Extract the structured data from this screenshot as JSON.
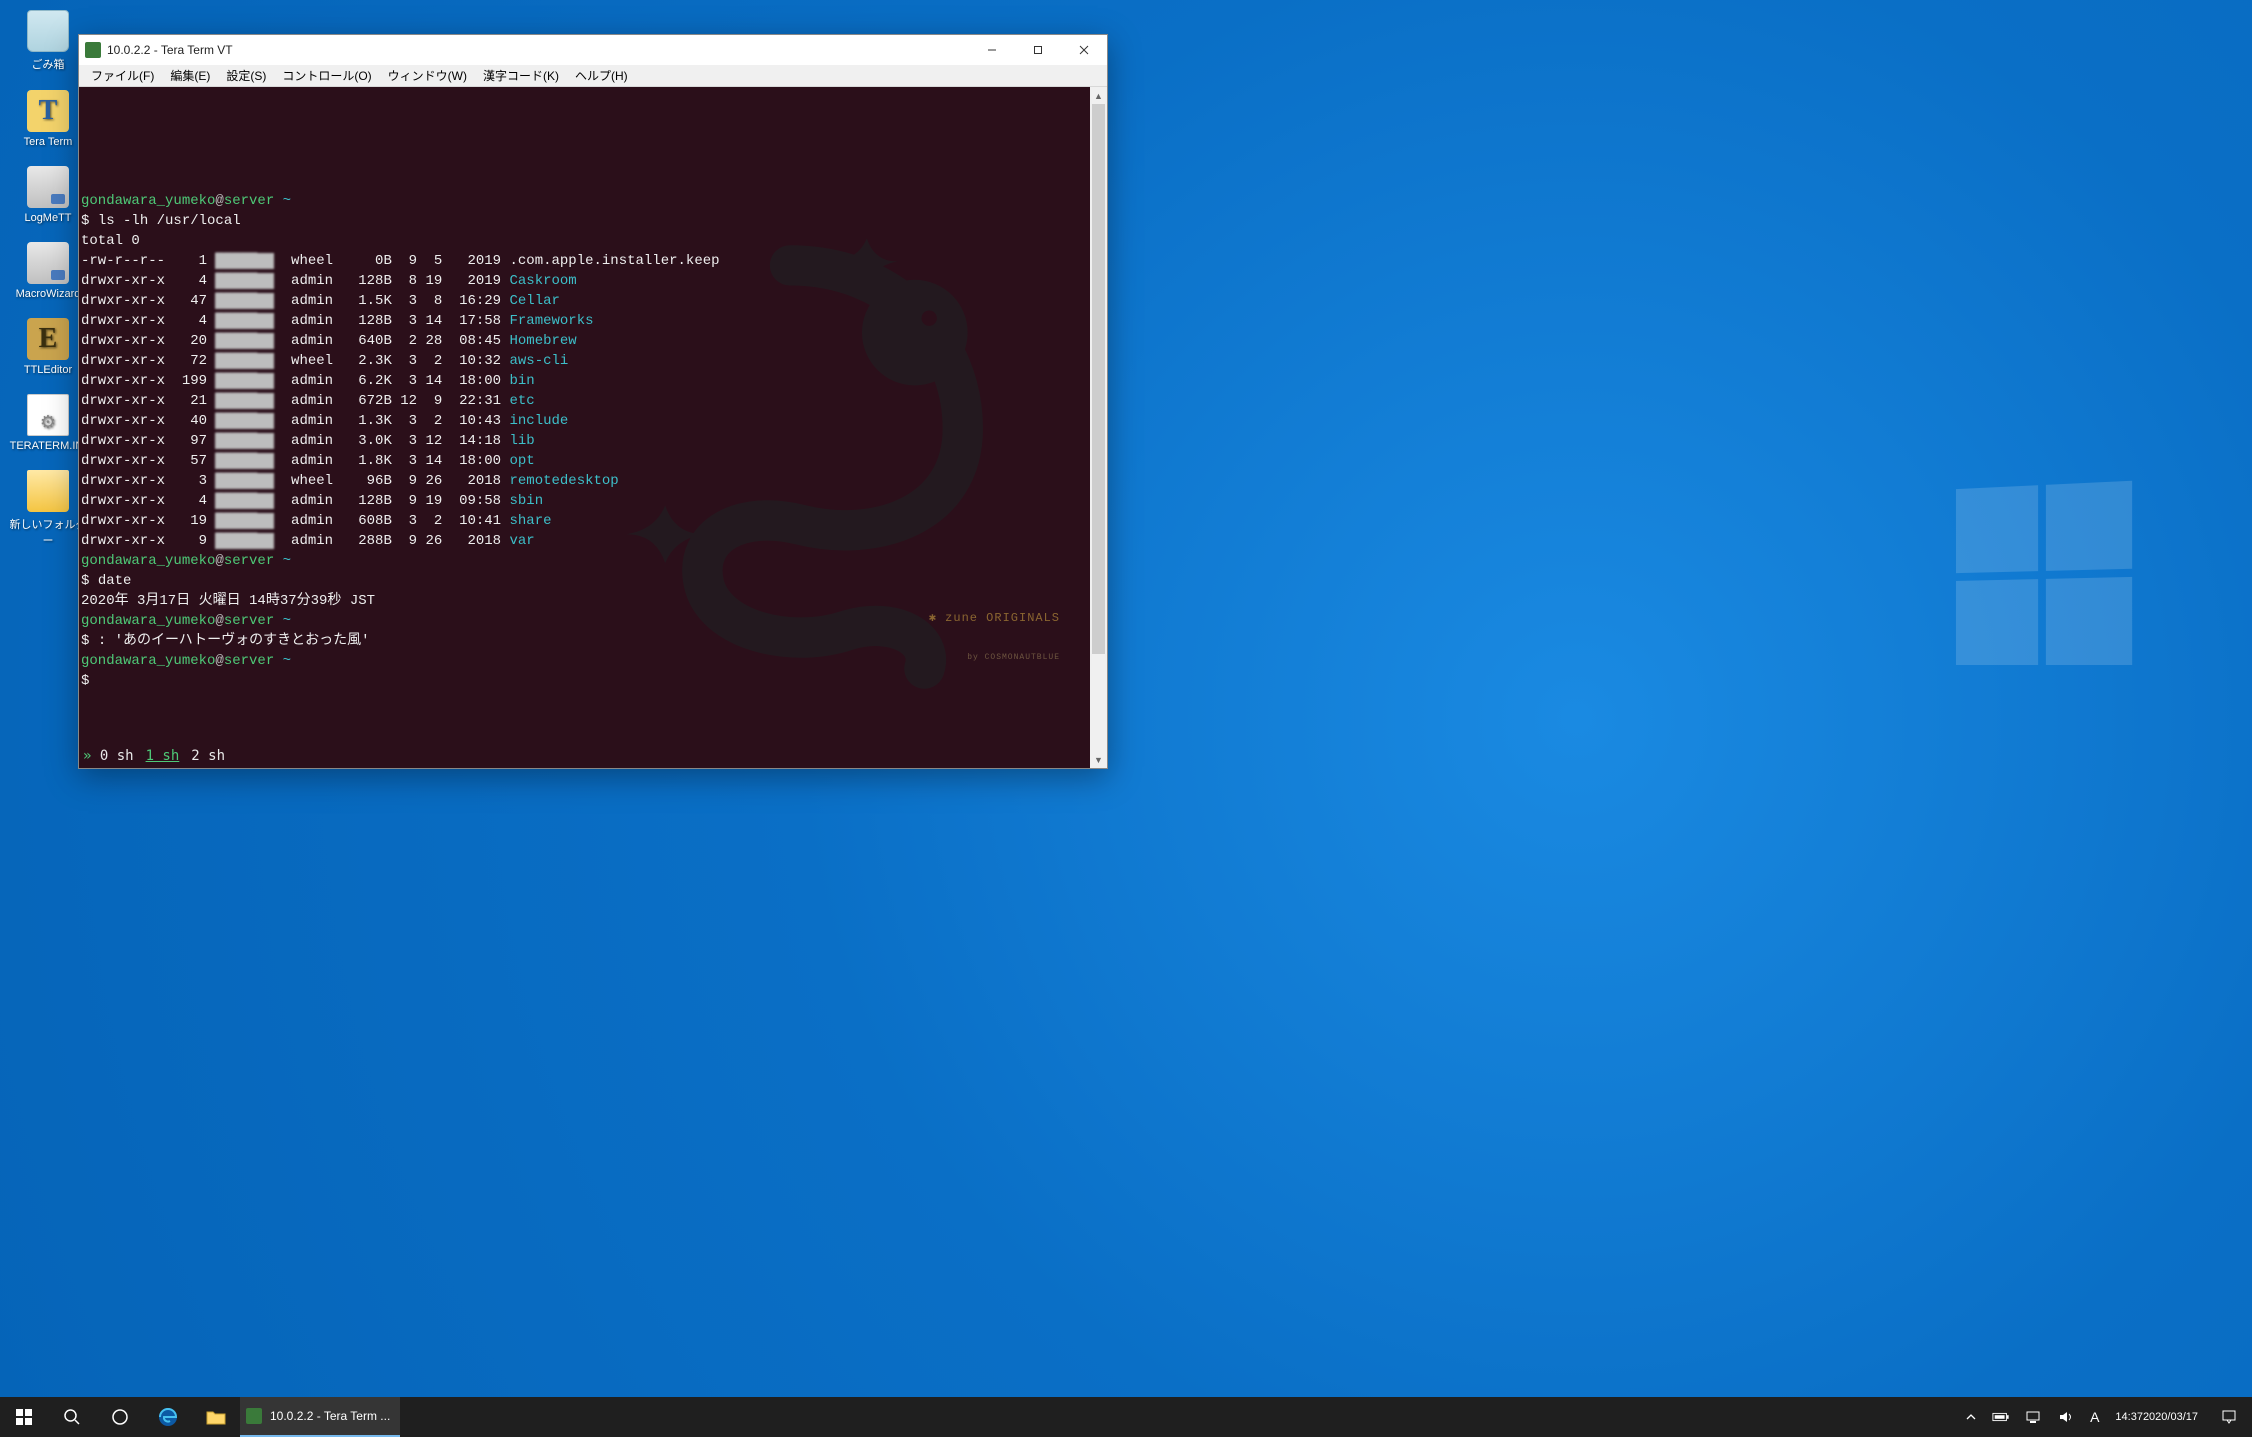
{
  "desktop": {
    "icons": [
      {
        "label": "ごみ箱",
        "kind": "recycle-bin"
      },
      {
        "label": "Tera Term",
        "kind": "teraterm"
      },
      {
        "label": "LogMeTT",
        "kind": "exe"
      },
      {
        "label": "MacroWizard",
        "kind": "exe"
      },
      {
        "label": "TTLEditor",
        "kind": "ttle"
      },
      {
        "label": "TERATERM.INI",
        "kind": "file"
      },
      {
        "label": "新しいフォルダー",
        "kind": "folder"
      }
    ]
  },
  "window": {
    "title": "10.0.2.2 - Tera Term VT",
    "menus": [
      "ファイル(F)",
      "編集(E)",
      "設定(S)",
      "コントロール(O)",
      "ウィンドウ(W)",
      "漢字コード(K)",
      "ヘルプ(H)"
    ]
  },
  "terminal": {
    "prompt_user": "gondawara_yumeko",
    "prompt_at": "@",
    "prompt_host": "server",
    "prompt_tail": " ~",
    "dollar": "$ ",
    "cmd1": "ls -lh /usr/local",
    "total_line": "total 0",
    "listing": [
      {
        "perm": "-rw-r--r--",
        "links": "1",
        "owner": "█████",
        "group": "wheel",
        "size": "0B",
        "m": "9",
        "d": "5",
        "t": "2019",
        "name": ".com.apple.installer.keep",
        "dir": false
      },
      {
        "perm": "drwxr-xr-x",
        "links": "4",
        "owner": "█████",
        "group": "admin",
        "size": "128B",
        "m": "8",
        "d": "19",
        "t": "2019",
        "name": "Caskroom",
        "dir": true
      },
      {
        "perm": "drwxr-xr-x",
        "links": "47",
        "owner": "█████",
        "group": "admin",
        "size": "1.5K",
        "m": "3",
        "d": "8",
        "t": "16:29",
        "name": "Cellar",
        "dir": true
      },
      {
        "perm": "drwxr-xr-x",
        "links": "4",
        "owner": "█████",
        "group": "admin",
        "size": "128B",
        "m": "3",
        "d": "14",
        "t": "17:58",
        "name": "Frameworks",
        "dir": true
      },
      {
        "perm": "drwxr-xr-x",
        "links": "20",
        "owner": "█████",
        "group": "admin",
        "size": "640B",
        "m": "2",
        "d": "28",
        "t": "08:45",
        "name": "Homebrew",
        "dir": true
      },
      {
        "perm": "drwxr-xr-x",
        "links": "72",
        "owner": "█████",
        "group": "wheel",
        "size": "2.3K",
        "m": "3",
        "d": "2",
        "t": "10:32",
        "name": "aws-cli",
        "dir": true
      },
      {
        "perm": "drwxr-xr-x",
        "links": "199",
        "owner": "█████",
        "group": "admin",
        "size": "6.2K",
        "m": "3",
        "d": "14",
        "t": "18:00",
        "name": "bin",
        "dir": true
      },
      {
        "perm": "drwxr-xr-x",
        "links": "21",
        "owner": "█████",
        "group": "admin",
        "size": "672B",
        "m": "12",
        "d": "9",
        "t": "22:31",
        "name": "etc",
        "dir": true
      },
      {
        "perm": "drwxr-xr-x",
        "links": "40",
        "owner": "█████",
        "group": "admin",
        "size": "1.3K",
        "m": "3",
        "d": "2",
        "t": "10:43",
        "name": "include",
        "dir": true
      },
      {
        "perm": "drwxr-xr-x",
        "links": "97",
        "owner": "█████",
        "group": "admin",
        "size": "3.0K",
        "m": "3",
        "d": "12",
        "t": "14:18",
        "name": "lib",
        "dir": true
      },
      {
        "perm": "drwxr-xr-x",
        "links": "57",
        "owner": "█████",
        "group": "admin",
        "size": "1.8K",
        "m": "3",
        "d": "14",
        "t": "18:00",
        "name": "opt",
        "dir": true
      },
      {
        "perm": "drwxr-xr-x",
        "links": "3",
        "owner": "█████",
        "group": "wheel",
        "size": "96B",
        "m": "9",
        "d": "26",
        "t": "2018",
        "name": "remotedesktop",
        "dir": true
      },
      {
        "perm": "drwxr-xr-x",
        "links": "4",
        "owner": "█████",
        "group": "admin",
        "size": "128B",
        "m": "9",
        "d": "19",
        "t": "09:58",
        "name": "sbin",
        "dir": true
      },
      {
        "perm": "drwxr-xr-x",
        "links": "19",
        "owner": "█████",
        "group": "admin",
        "size": "608B",
        "m": "3",
        "d": "2",
        "t": "10:41",
        "name": "share",
        "dir": true
      },
      {
        "perm": "drwxr-xr-x",
        "links": "9",
        "owner": "█████",
        "group": "admin",
        "size": "288B",
        "m": "9",
        "d": "26",
        "t": "2018",
        "name": "var",
        "dir": true
      }
    ],
    "cmd2": "date",
    "date_output": "2020年 3月17日 火曜日 14時37分39秒 JST",
    "cmd3": ": 'あのイーハトーヴォのすきとおった風'",
    "tabs": [
      {
        "label": "0 sh",
        "active": false
      },
      {
        "label": "1 sh",
        "active": true
      },
      {
        "label": "2 sh",
        "active": false
      }
    ],
    "tab_prefix": "» ",
    "watermark": "✱ zune ORIGINALS",
    "watermark_sub": "by COSMONAUTBLUE"
  },
  "taskbar": {
    "running_label": "10.0.2.2 - Tera Term ...",
    "ime_label": "A",
    "clock_time": "14:37",
    "clock_date": "2020/03/17"
  }
}
